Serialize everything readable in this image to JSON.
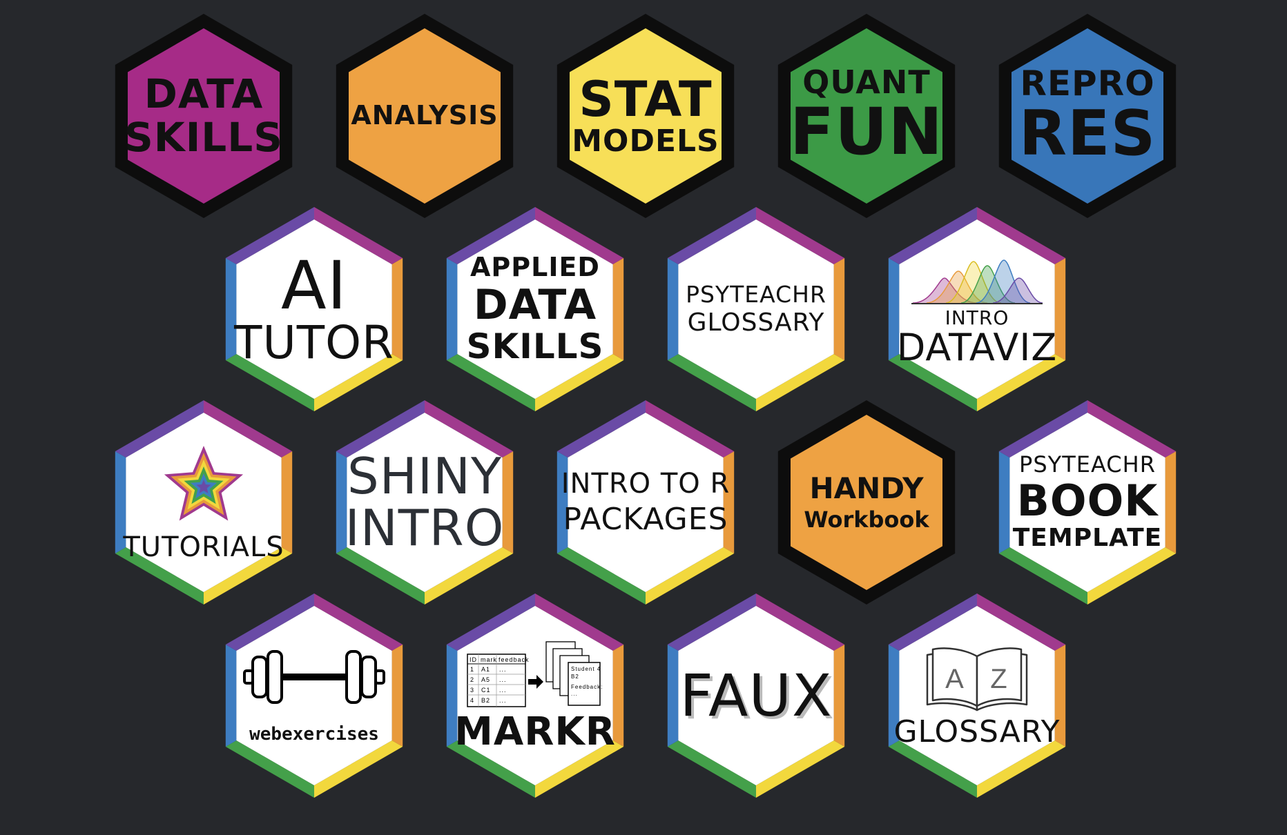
{
  "colors": {
    "background": "#26282c",
    "frame": "#0d0d0d",
    "magenta": "#a62b87",
    "orange": "#eea243",
    "yellow": "#f7df58",
    "green": "#3c9a46",
    "blue": "#3876b9",
    "rainbow": [
      "#a03a8e",
      "#e89a3c",
      "#f2d83d",
      "#44a04a",
      "#3e7dc1",
      "#6a4ba6"
    ]
  },
  "badges": [
    {
      "id": "data-skills",
      "lines": [
        "DATA",
        "SKILLS"
      ],
      "fill": "magenta"
    },
    {
      "id": "analysis",
      "lines": [
        "ANALYSIS"
      ],
      "fill": "orange"
    },
    {
      "id": "stat-models",
      "lines": [
        "STAT",
        "MODELS"
      ],
      "fill": "yellow"
    },
    {
      "id": "quant-fun",
      "lines": [
        "QUANT",
        "FUN"
      ],
      "fill": "green"
    },
    {
      "id": "repro-res",
      "lines": [
        "REPRO",
        "RES"
      ],
      "fill": "blue"
    },
    {
      "id": "ai-tutor",
      "lines": [
        "AI",
        "TUTOR"
      ]
    },
    {
      "id": "applied-data-skills",
      "lines": [
        "APPLIED",
        "DATA",
        "SKILLS"
      ]
    },
    {
      "id": "psyteachr-glossary",
      "lines": [
        "PSYTEACHR",
        "GLOSSARY"
      ]
    },
    {
      "id": "intro-dataviz",
      "lines": [
        "INTRO",
        "DATAVIZ"
      ],
      "icon": "density-curves-icon"
    },
    {
      "id": "tutorials",
      "lines": [
        "TUTORIALS"
      ],
      "icon": "rainbow-star-icon"
    },
    {
      "id": "shiny-intro",
      "lines": [
        "SHINY",
        "INTRO"
      ]
    },
    {
      "id": "intro-to-r-packages",
      "lines": [
        "INTRO TO R",
        "PACKAGES"
      ]
    },
    {
      "id": "handy-workbook",
      "lines": [
        "HANDY",
        "Workbook"
      ],
      "fill": "orange"
    },
    {
      "id": "psyteachr-book-template",
      "lines": [
        "PSYTEACHR",
        "BOOK",
        "TEMPLATE"
      ]
    },
    {
      "id": "webexercises",
      "lines": [
        "webexercises"
      ],
      "icon": "barbell-icon"
    },
    {
      "id": "markr",
      "lines": [
        "MARKR"
      ],
      "icon": "marking-sheets-icon",
      "art": {
        "table_headers": [
          "ID",
          "mark",
          "feedback"
        ],
        "table_rows": [
          [
            "1",
            "A1",
            "..."
          ],
          [
            "2",
            "A5",
            "..."
          ],
          [
            "3",
            "C1",
            "..."
          ],
          [
            "4",
            "B2",
            "..."
          ]
        ],
        "sheet_title": "Student 4",
        "sheet_value": "B2",
        "sheet_feedback": "Feedback:",
        "sheet_dots": "..."
      }
    },
    {
      "id": "faux",
      "lines": [
        "FAUX"
      ]
    },
    {
      "id": "glossary",
      "lines": [
        "GLOSSARY"
      ],
      "icon": "open-book-icon",
      "art": {
        "left_letter": "A",
        "right_letter": "Z"
      }
    }
  ]
}
